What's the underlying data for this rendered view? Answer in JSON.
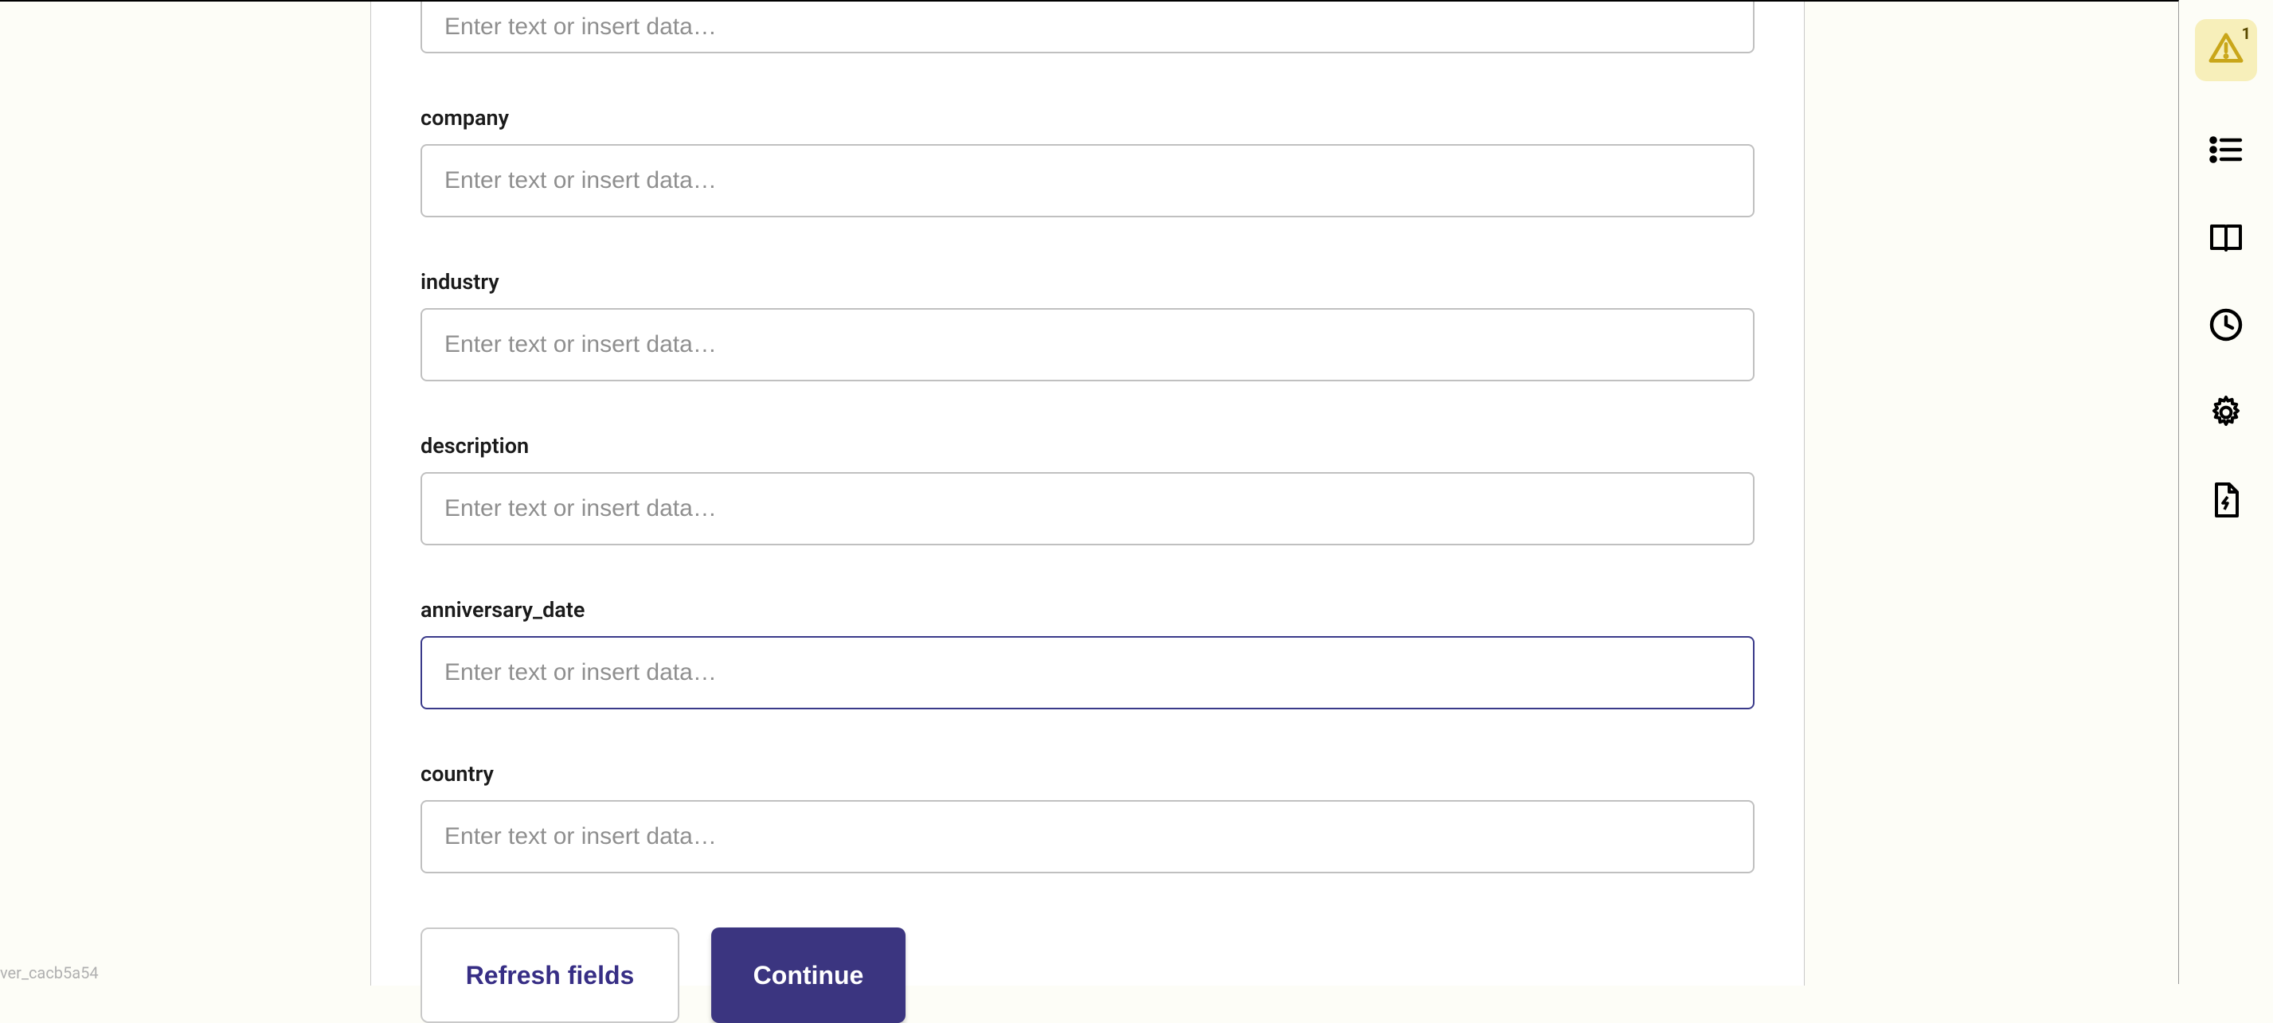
{
  "form": {
    "fields": [
      {
        "key": "field0",
        "label": "",
        "placeholder": "Enter text or insert data…",
        "focused": false
      },
      {
        "key": "company",
        "label": "company",
        "placeholder": "Enter text or insert data…",
        "focused": false
      },
      {
        "key": "industry",
        "label": "industry",
        "placeholder": "Enter text or insert data…",
        "focused": false
      },
      {
        "key": "description",
        "label": "description",
        "placeholder": "Enter text or insert data…",
        "focused": false
      },
      {
        "key": "anniversary_date",
        "label": "anniversary_date",
        "placeholder": "Enter text or insert data…",
        "focused": true
      },
      {
        "key": "country",
        "label": "country",
        "placeholder": "Enter text or insert data…",
        "focused": false
      }
    ],
    "buttons": {
      "refresh": "Refresh fields",
      "continue": "Continue"
    }
  },
  "alert": {
    "count": "1"
  },
  "footer": {
    "version": "ver_cacb5a54"
  },
  "colors": {
    "primary": "#3b3580",
    "alert_bg": "#f7efba"
  },
  "rail_icons": [
    {
      "name": "alert-icon"
    },
    {
      "name": "list-icon"
    },
    {
      "name": "book-icon"
    },
    {
      "name": "clock-icon"
    },
    {
      "name": "gear-icon"
    },
    {
      "name": "file-bolt-icon"
    }
  ]
}
